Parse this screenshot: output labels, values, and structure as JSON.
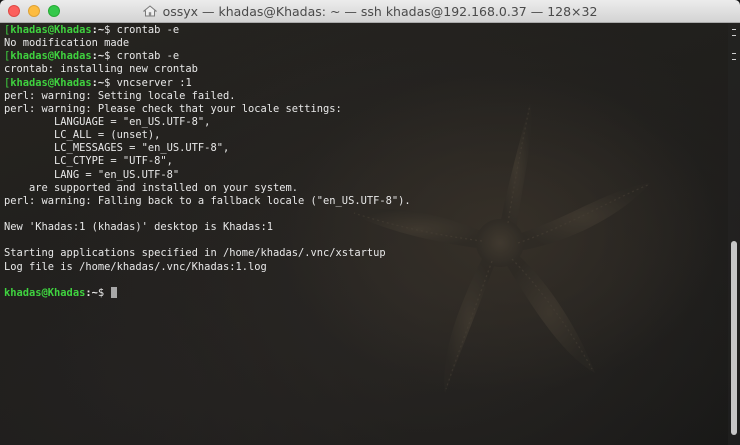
{
  "window": {
    "title": "ossyx — khadas@Khadas: ~ — ssh khadas@192.168.0.37 — 128×32",
    "icon": "home-folder-icon"
  },
  "terminal": {
    "prompt_user": "khadas@Khadas",
    "prompt_path": ":~",
    "prompt_symbol": "$",
    "lines": [
      {
        "type": "prompt",
        "marker": "[",
        "command": " crontab -e"
      },
      {
        "type": "text",
        "text": "No modification made"
      },
      {
        "type": "prompt",
        "marker": "[",
        "command": " crontab -e"
      },
      {
        "type": "text",
        "text": "crontab: installing new crontab"
      },
      {
        "type": "prompt",
        "marker": "[",
        "command": " vncserver :1"
      },
      {
        "type": "text",
        "text": "perl: warning: Setting locale failed."
      },
      {
        "type": "text",
        "text": "perl: warning: Please check that your locale settings:"
      },
      {
        "type": "text",
        "text": "        LANGUAGE = \"en_US.UTF-8\","
      },
      {
        "type": "text",
        "text": "        LC_ALL = (unset),"
      },
      {
        "type": "text",
        "text": "        LC_MESSAGES = \"en_US.UTF-8\","
      },
      {
        "type": "text",
        "text": "        LC_CTYPE = \"UTF-8\","
      },
      {
        "type": "text",
        "text": "        LANG = \"en_US.UTF-8\""
      },
      {
        "type": "text",
        "text": "    are supported and installed on your system."
      },
      {
        "type": "text",
        "text": "perl: warning: Falling back to a fallback locale (\"en_US.UTF-8\")."
      },
      {
        "type": "text",
        "text": ""
      },
      {
        "type": "text",
        "text": "New 'Khadas:1 (khadas)' desktop is Khadas:1"
      },
      {
        "type": "text",
        "text": ""
      },
      {
        "type": "text",
        "text": "Starting applications specified in /home/khadas/.vnc/xstartup"
      },
      {
        "type": "text",
        "text": "Log file is /home/khadas/.vnc/Khadas:1.log"
      },
      {
        "type": "text",
        "text": ""
      },
      {
        "type": "prompt",
        "marker": "",
        "command": " ",
        "cursor": true
      }
    ]
  },
  "colors": {
    "prompt_user": "#3fd23f",
    "text": "#e8e8e8",
    "background": "#1e1d1b"
  }
}
